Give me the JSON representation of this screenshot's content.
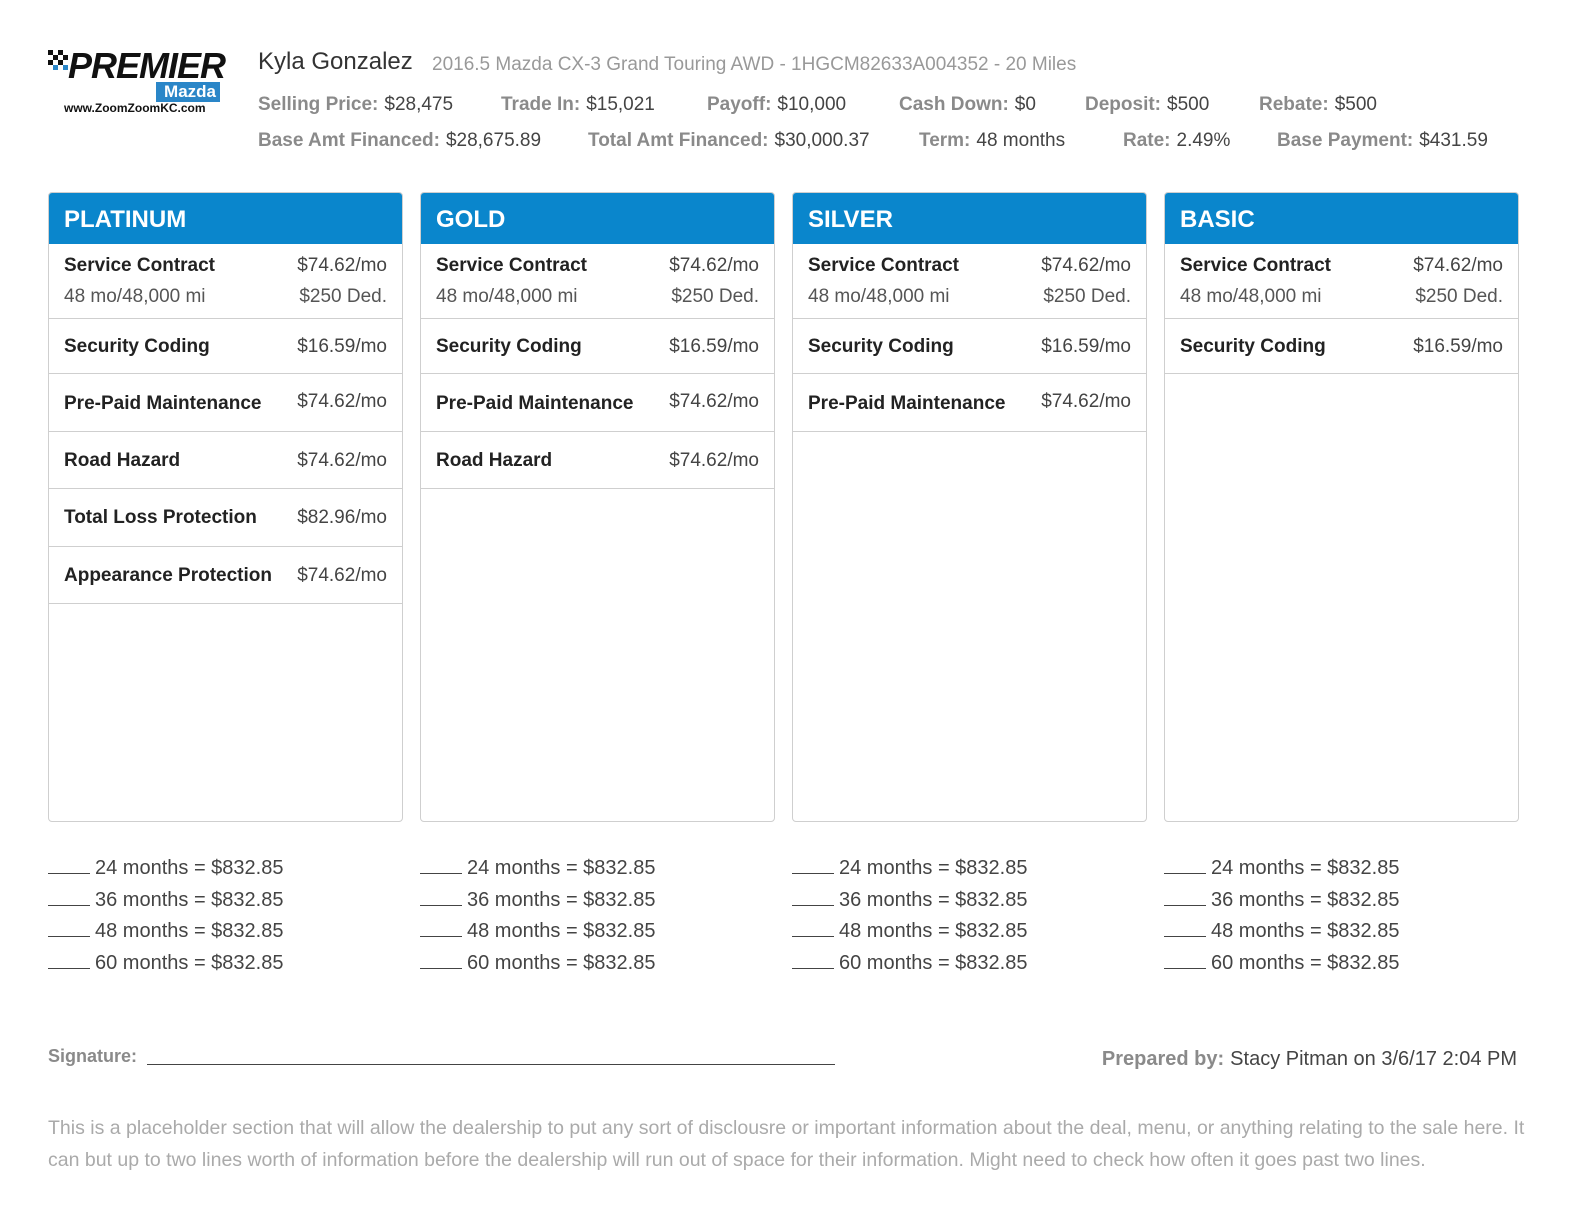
{
  "logo": {
    "wordmark": "PREMIER",
    "brand": "Mazda",
    "url": "www.ZoomZoomKC.com"
  },
  "customer_name": "Kyla Gonzalez",
  "vehicle": "2016.5 Mazda CX-3 Grand Touring AWD - 1HGCM82633A004352 - 20 Miles",
  "deal": {
    "selling_price": {
      "label": "Selling Price:",
      "value": "$28,475"
    },
    "trade_in": {
      "label": "Trade In:",
      "value": "$15,021"
    },
    "payoff": {
      "label": "Payoff:",
      "value": "$10,000"
    },
    "cash_down": {
      "label": "Cash Down:",
      "value": "$0"
    },
    "deposit": {
      "label": "Deposit:",
      "value": "$500"
    },
    "rebate": {
      "label": "Rebate:",
      "value": "$500"
    },
    "base_amt_financed": {
      "label": "Base Amt Financed:",
      "value": "$28,675.89"
    },
    "total_amt_financed": {
      "label": "Total Amt Financed:",
      "value": "$30,000.37"
    },
    "term": {
      "label": "Term:",
      "value": "48 months"
    },
    "rate": {
      "label": "Rate:",
      "value": "2.49%"
    },
    "base_payment": {
      "label": "Base Payment:",
      "value": "$431.59"
    }
  },
  "packages": [
    {
      "title": "PLATINUM",
      "service": {
        "name": "Service Contract",
        "price": "$74.62/mo",
        "coverage": "48 mo/48,000 mi",
        "deductible": "$250 Ded."
      },
      "items": [
        {
          "name": "Security Coding",
          "price": "$16.59/mo"
        },
        {
          "name": "Pre-Paid Maintenance",
          "price": "$74.62/mo"
        },
        {
          "name": "Road Hazard",
          "price": "$74.62/mo"
        },
        {
          "name": "Total Loss Protection",
          "price": "$82.96/mo"
        },
        {
          "name": "Appearance Protection",
          "price": "$74.62/mo"
        }
      ],
      "terms": [
        "24 months = $832.85",
        "36 months = $832.85",
        "48 months = $832.85",
        "60 months = $832.85"
      ]
    },
    {
      "title": "GOLD",
      "service": {
        "name": "Service Contract",
        "price": "$74.62/mo",
        "coverage": "48 mo/48,000 mi",
        "deductible": "$250 Ded."
      },
      "items": [
        {
          "name": "Security Coding",
          "price": "$16.59/mo"
        },
        {
          "name": "Pre-Paid Maintenance",
          "price": "$74.62/mo"
        },
        {
          "name": "Road Hazard",
          "price": "$74.62/mo"
        }
      ],
      "terms": [
        "24 months = $832.85",
        "36 months = $832.85",
        "48 months = $832.85",
        "60 months = $832.85"
      ]
    },
    {
      "title": "SILVER",
      "service": {
        "name": "Service Contract",
        "price": "$74.62/mo",
        "coverage": "48 mo/48,000 mi",
        "deductible": "$250 Ded."
      },
      "items": [
        {
          "name": "Security Coding",
          "price": "$16.59/mo"
        },
        {
          "name": "Pre-Paid Maintenance",
          "price": "$74.62/mo"
        }
      ],
      "terms": [
        "24 months = $832.85",
        "36 months = $832.85",
        "48 months = $832.85",
        "60 months = $832.85"
      ]
    },
    {
      "title": "BASIC",
      "service": {
        "name": "Service Contract",
        "price": "$74.62/mo",
        "coverage": "48 mo/48,000 mi",
        "deductible": "$250 Ded."
      },
      "items": [
        {
          "name": "Security Coding",
          "price": "$16.59/mo"
        }
      ],
      "terms": [
        "24 months = $832.85",
        "36 months = $832.85",
        "48 months = $832.85",
        "60 months = $832.85"
      ]
    }
  ],
  "signature_label": "Signature:",
  "prepared": {
    "label": "Prepared by:",
    "value": "Stacy Pitman on 3/6/17 2:04 PM"
  },
  "disclosure": "This is a placeholder section that will allow the dealership to put any sort of disclousre or important information about the deal, menu, or anything relating to the sale here. It can but up to two lines worth of information before the dealership will run out of space for their information. Might need to check how often it goes past two lines.",
  "colors": {
    "header_blue": "#0a86cc",
    "logo_blue": "#2a86c8"
  }
}
